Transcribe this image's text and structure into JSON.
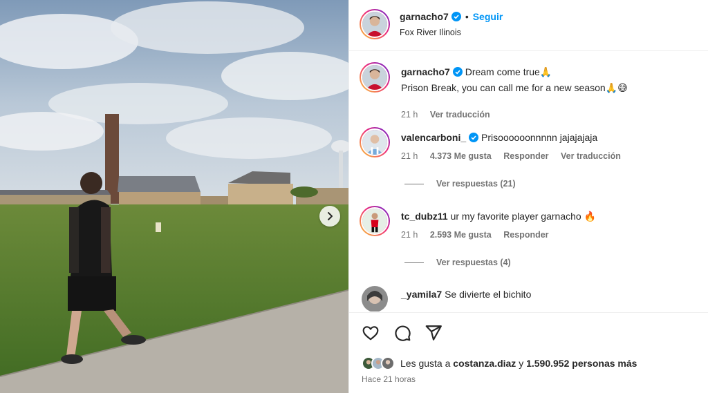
{
  "post": {
    "username": "garnacho7",
    "follow_label": "Seguir",
    "dot": "•",
    "location": "Fox River Ilinois"
  },
  "caption": {
    "username": "garnacho7",
    "line1": "Dream come true🙏",
    "line2": "Prison Break, you can call me for a new season🙏😅",
    "time": "21 h",
    "translate": "Ver traducción"
  },
  "comments": [
    {
      "username": "valencarboni_",
      "text": "Prisoooooonnnnn jajajajaja",
      "time": "21 h",
      "likes": "4.373 Me gusta",
      "reply": "Responder",
      "translate": "Ver traducción",
      "view_replies": "Ver respuestas (21)"
    },
    {
      "username": "tc_dubz11",
      "text": "ur my favorite player garnacho 🔥",
      "time": "21 h",
      "likes": "2.593 Me gusta",
      "reply": "Responder",
      "view_replies": "Ver respuestas (4)"
    },
    {
      "username": "_yamila7",
      "text": "Se divierte el bichito"
    }
  ],
  "likes": {
    "prefix": "Les gusta a ",
    "user": "costanza.diaz",
    "mid": " y ",
    "count": "1.590.952 personas más"
  },
  "posted": "Hace 21 horas",
  "colors": {
    "verified": "#0095f6",
    "follow": "#0095f6",
    "muted": "#737373"
  },
  "icons": [
    "heart-icon",
    "comment-icon",
    "share-icon",
    "verified-icon",
    "chevron-right-icon"
  ]
}
